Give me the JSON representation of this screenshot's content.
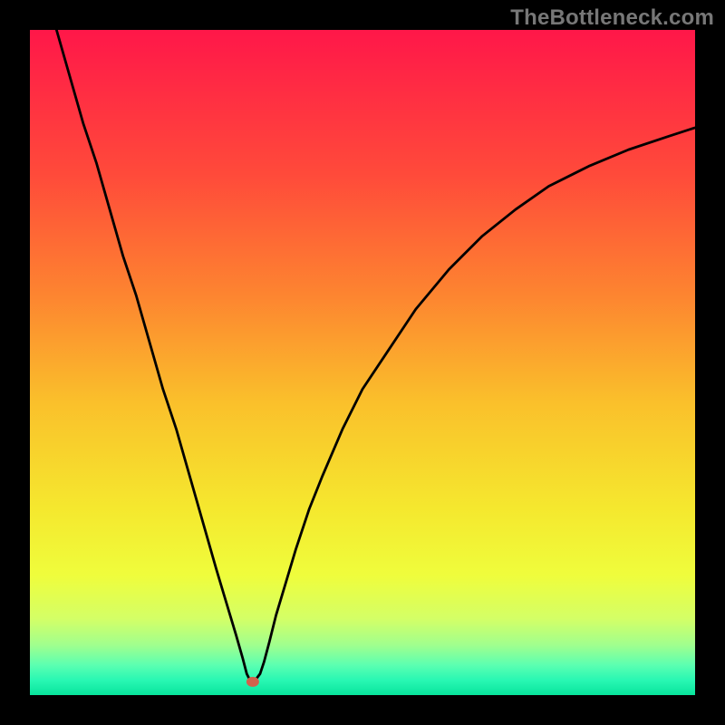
{
  "watermark": {
    "text": "TheBottleneck.com"
  },
  "chart_data": {
    "type": "line",
    "title": "",
    "xlabel": "",
    "ylabel": "",
    "xlim": [
      0,
      100
    ],
    "ylim": [
      0,
      100
    ],
    "grid": false,
    "legend": false,
    "marker": {
      "x": 33.5,
      "y": 2.0,
      "color": "#d1614c"
    },
    "series": [
      {
        "name": "bottleneck-curve",
        "x": [
          4,
          6,
          8,
          10,
          12,
          14,
          16,
          18,
          20,
          22,
          24,
          26,
          28,
          29.5,
          31,
          32,
          32.6,
          33,
          33.5,
          34,
          34.6,
          35.2,
          36,
          37,
          38.5,
          40,
          42,
          44,
          47,
          50,
          54,
          58,
          63,
          68,
          73,
          78,
          84,
          90,
          96,
          100
        ],
        "y": [
          100,
          93,
          86,
          80,
          73,
          66,
          60,
          53,
          46,
          40,
          33,
          26,
          19,
          14,
          9,
          5.5,
          3.2,
          2.4,
          2.0,
          2.4,
          3.2,
          5.0,
          8,
          12,
          17,
          22,
          28,
          33,
          40,
          46,
          52,
          58,
          64,
          69,
          73,
          76.5,
          79.5,
          82,
          84,
          85.3
        ]
      }
    ],
    "background_gradient": {
      "stops": [
        {
          "offset": 0.0,
          "color": "#ff1749"
        },
        {
          "offset": 0.22,
          "color": "#ff4b3a"
        },
        {
          "offset": 0.4,
          "color": "#fd8530"
        },
        {
          "offset": 0.56,
          "color": "#fac02b"
        },
        {
          "offset": 0.72,
          "color": "#f5e82e"
        },
        {
          "offset": 0.82,
          "color": "#effd3c"
        },
        {
          "offset": 0.885,
          "color": "#d4ff66"
        },
        {
          "offset": 0.925,
          "color": "#a0ff8e"
        },
        {
          "offset": 0.955,
          "color": "#5bffb1"
        },
        {
          "offset": 0.978,
          "color": "#28f7b3"
        },
        {
          "offset": 1.0,
          "color": "#08e49c"
        }
      ]
    }
  }
}
